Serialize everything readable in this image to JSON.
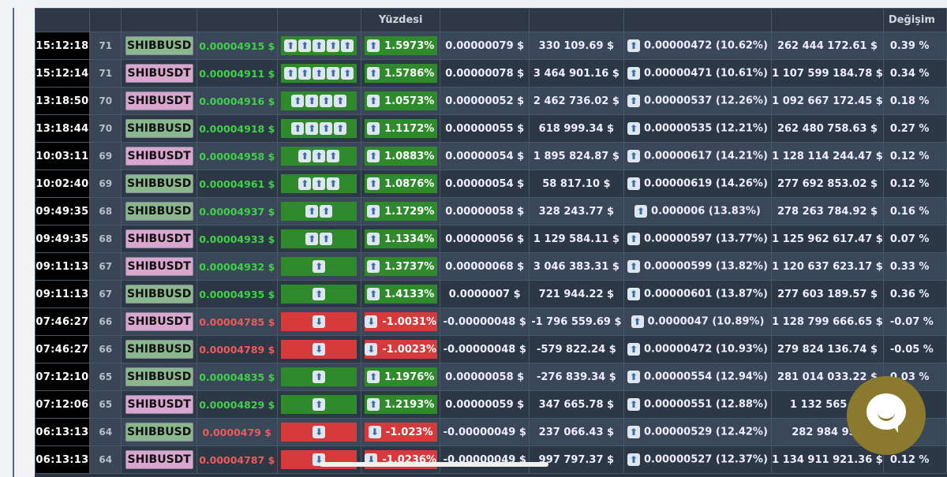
{
  "header": {
    "pct_label": "Yüzdesi",
    "change_label": "Değişim"
  },
  "colors": {
    "green": "#3fd147",
    "red": "#ef5a5a",
    "up_bar": "#2e8a2a",
    "down_bar": "#d63a3a"
  },
  "rows": [
    {
      "time": "15:12:18",
      "n": "71",
      "sym": "SHIBBUSD",
      "price": "0.00004915 $",
      "dir": "up",
      "arrows": 5,
      "pct": "1.5973%",
      "diff": "0.00000079 $",
      "vol": "330 109.69 $",
      "min": "0.00000472",
      "minpct": "(10.62%)",
      "total": "262 444 172.61 $",
      "chg": "0.39 %"
    },
    {
      "time": "15:12:14",
      "n": "71",
      "sym": "SHIBUSDT",
      "price": "0.00004911 $",
      "dir": "up",
      "arrows": 5,
      "pct": "1.5786%",
      "diff": "0.00000078 $",
      "vol": "3 464 901.16 $",
      "min": "0.00000471",
      "minpct": "(10.61%)",
      "total": "1 107 599 184.78 $",
      "chg": "0.34 %"
    },
    {
      "time": "13:18:50",
      "n": "70",
      "sym": "SHIBUSDT",
      "price": "0.00004916 $",
      "dir": "up",
      "arrows": 4,
      "pct": "1.0573%",
      "diff": "0.00000052 $",
      "vol": "2 462 736.02 $",
      "min": "0.00000537",
      "minpct": "(12.26%)",
      "total": "1 092 667 172.45 $",
      "chg": "0.18 %"
    },
    {
      "time": "13:18:44",
      "n": "70",
      "sym": "SHIBBUSD",
      "price": "0.00004918 $",
      "dir": "up",
      "arrows": 4,
      "pct": "1.1172%",
      "diff": "0.00000055 $",
      "vol": "618 999.34 $",
      "min": "0.00000535",
      "minpct": "(12.21%)",
      "total": "262 480 758.63 $",
      "chg": "0.27 %"
    },
    {
      "time": "10:03:11",
      "n": "69",
      "sym": "SHIBUSDT",
      "price": "0.00004958 $",
      "dir": "up",
      "arrows": 3,
      "pct": "1.0883%",
      "diff": "0.00000054 $",
      "vol": "1 895 824.87 $",
      "min": "0.00000617",
      "minpct": "(14.21%)",
      "total": "1 128 114 244.47 $",
      "chg": "0.12 %"
    },
    {
      "time": "10:02:40",
      "n": "69",
      "sym": "SHIBBUSD",
      "price": "0.00004961 $",
      "dir": "up",
      "arrows": 3,
      "pct": "1.0876%",
      "diff": "0.00000054 $",
      "vol": "58 817.10 $",
      "min": "0.00000619",
      "minpct": "(14.26%)",
      "total": "277 692 853.02 $",
      "chg": "0.12 %"
    },
    {
      "time": "09:49:35",
      "n": "68",
      "sym": "SHIBBUSD",
      "price": "0.00004937 $",
      "dir": "up",
      "arrows": 2,
      "pct": "1.1729%",
      "diff": "0.00000058 $",
      "vol": "328 243.77 $",
      "min": "0.000006",
      "minpct": "(13.83%)",
      "total": "278 263 784.92 $",
      "chg": "0.16 %"
    },
    {
      "time": "09:49:35",
      "n": "68",
      "sym": "SHIBUSDT",
      "price": "0.00004933 $",
      "dir": "up",
      "arrows": 2,
      "pct": "1.1334%",
      "diff": "0.00000056 $",
      "vol": "1 129 584.11 $",
      "min": "0.00000597",
      "minpct": "(13.77%)",
      "total": "1 125 962 617.47 $",
      "chg": "0.07 %"
    },
    {
      "time": "09:11:13",
      "n": "67",
      "sym": "SHIBUSDT",
      "price": "0.00004932 $",
      "dir": "up",
      "arrows": 1,
      "pct": "1.3737%",
      "diff": "0.00000068 $",
      "vol": "3 046 383.31 $",
      "min": "0.00000599",
      "minpct": "(13.82%)",
      "total": "1 120 637 623.17 $",
      "chg": "0.33 %"
    },
    {
      "time": "09:11:13",
      "n": "67",
      "sym": "SHIBBUSD",
      "price": "0.00004935 $",
      "dir": "up",
      "arrows": 1,
      "pct": "1.4133%",
      "diff": "0.0000007 $",
      "vol": "721 944.22 $",
      "min": "0.00000601",
      "minpct": "(13.87%)",
      "total": "277 603 189.57 $",
      "chg": "0.36 %"
    },
    {
      "time": "07:46:27",
      "n": "66",
      "sym": "SHIBUSDT",
      "price": "0.00004785 $",
      "dir": "down",
      "arrows": 1,
      "pct": "-1.0031%",
      "diff": "-0.00000048 $",
      "vol": "-1 796 559.69 $",
      "min": "0.0000047",
      "minpct": "(10.89%)",
      "total": "1 128 799 666.65 $",
      "chg": "-0.07 %"
    },
    {
      "time": "07:46:27",
      "n": "66",
      "sym": "SHIBBUSD",
      "price": "0.00004789 $",
      "dir": "down",
      "arrows": 1,
      "pct": "-1.0023%",
      "diff": "-0.00000048 $",
      "vol": "-579 822.24 $",
      "min": "0.00000472",
      "minpct": "(10.93%)",
      "total": "279 824 136.74 $",
      "chg": "-0.05 %"
    },
    {
      "time": "07:12:10",
      "n": "65",
      "sym": "SHIBBUSD",
      "price": "0.00004835 $",
      "dir": "up",
      "arrows": 1,
      "pct": "1.1976%",
      "diff": "0.00000058 $",
      "vol": "-276 839.34 $",
      "min": "0.00000554",
      "minpct": "(12.94%)",
      "total": "281 014 033.22 $",
      "chg": "0.03 %"
    },
    {
      "time": "07:12:06",
      "n": "65",
      "sym": "SHIBUSDT",
      "price": "0.00004829 $",
      "dir": "up",
      "arrows": 1,
      "pct": "1.2193%",
      "diff": "0.00000059 $",
      "vol": "347 665.78 $",
      "min": "0.00000551",
      "minpct": "(12.88%)",
      "total": "1 132 565 57",
      "chg": ""
    },
    {
      "time": "06:13:13",
      "n": "64",
      "sym": "SHIBBUSD",
      "price": "0.0000479 $",
      "dir": "down",
      "arrows": 1,
      "pct": "-1.023%",
      "diff": "-0.00000049 $",
      "vol": "237 066.43 $",
      "min": "0.00000529",
      "minpct": "(12.42%)",
      "total": "282 984 957",
      "chg": ""
    },
    {
      "time": "06:13:13",
      "n": "64",
      "sym": "SHIBUSDT",
      "price": "0.00004787 $",
      "dir": "down",
      "arrows": 1,
      "pct": "-1.0236%",
      "diff": "-0.00000049 $",
      "vol": "997 797.37 $",
      "min": "0.00000527",
      "minpct": "(12.37%)",
      "total": "1 134 911 921.36 $",
      "chg": "0.12 %"
    }
  ]
}
